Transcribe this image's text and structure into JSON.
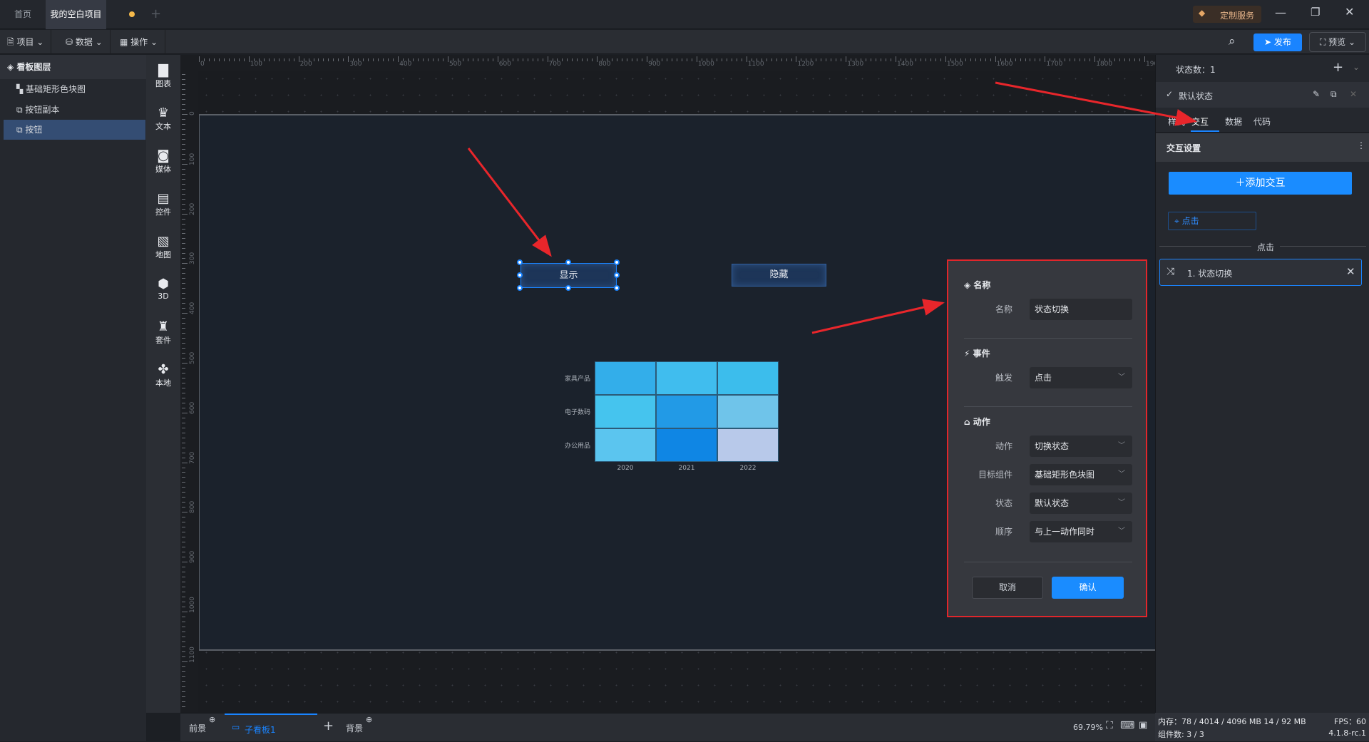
{
  "titlebar": {
    "tabs": [
      {
        "label": "首页"
      },
      {
        "label": "我的空白项目"
      }
    ],
    "custom_service": "定制服务"
  },
  "toolbar": {
    "project": "项目",
    "data": "数据",
    "operate": "操作",
    "publish": "发布",
    "preview": "预览"
  },
  "layers": {
    "title": "看板图层",
    "items": [
      {
        "label": "基础矩形色块图"
      },
      {
        "label": "按钮副本"
      },
      {
        "label": "按钮"
      }
    ]
  },
  "iconbar": [
    {
      "label": "图表"
    },
    {
      "label": "文本"
    },
    {
      "label": "媒体"
    },
    {
      "label": "控件"
    },
    {
      "label": "地图"
    },
    {
      "label": "3D"
    },
    {
      "label": "套件"
    },
    {
      "label": "本地"
    }
  ],
  "canvas": {
    "show_button": "显示",
    "hide_button": "隐藏"
  },
  "chart_data": {
    "type": "heatmap",
    "x_categories": [
      "2020",
      "2021",
      "2022"
    ],
    "y_categories": [
      "家具产品",
      "电子数码",
      "办公用品"
    ],
    "cell_colors": [
      [
        "#33aeea",
        "#40bdee",
        "#3cbdec"
      ],
      [
        "#45c4ee",
        "#229ae6",
        "#6fc4ea"
      ],
      [
        "#5bc5ef",
        "#0f86e4",
        "#b8c9ea"
      ]
    ]
  },
  "popup": {
    "name_section": "名称",
    "name_label": "名称",
    "name_value": "状态切换",
    "event_section": "事件",
    "trigger_label": "触发",
    "trigger_value": "点击",
    "action_section": "动作",
    "action_label": "动作",
    "action_value": "切换状态",
    "target_label": "目标组件",
    "target_value": "基础矩形色块图",
    "state_label": "状态",
    "state_value": "默认状态",
    "order_label": "顺序",
    "order_value": "与上一动作同时",
    "cancel": "取消",
    "confirm": "确认"
  },
  "right": {
    "state_count": "状态数：1",
    "default_state": "默认状态",
    "tabs": [
      {
        "label": "样式"
      },
      {
        "label": "交互"
      },
      {
        "label": "数据"
      },
      {
        "label": "代码"
      }
    ],
    "section": "交互设置",
    "add": "＋添加交互",
    "event_tag": "点击",
    "divider": "点击",
    "item": "1. 状态切换"
  },
  "bottom": {
    "foreground": "前景",
    "subboard": "子看板1",
    "background": "背景",
    "zoom": "69.79%"
  },
  "status": {
    "memory": "内存：78 / 4014 / 4096 MB  14 / 92 MB",
    "fps": "FPS：60",
    "components": "组件数: 3 / 3",
    "version": "4.1.8-rc.1"
  }
}
